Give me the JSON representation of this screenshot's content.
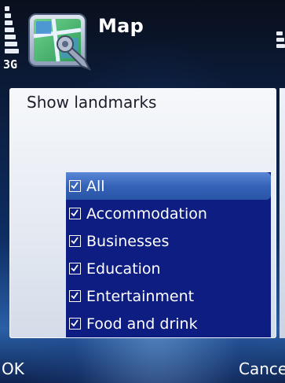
{
  "statusbar": {
    "network": "3G",
    "app_title": "Map",
    "app_icon": "map-app-icon",
    "signal_icon": "signal-strength-icon",
    "battery_icon": "battery-icon"
  },
  "dialog": {
    "title": "Show landmarks",
    "items": [
      {
        "label": "All",
        "checked": true,
        "selected": true
      },
      {
        "label": "Accommodation",
        "checked": true,
        "selected": false
      },
      {
        "label": "Businesses",
        "checked": true,
        "selected": false
      },
      {
        "label": "Education",
        "checked": true,
        "selected": false
      },
      {
        "label": "Entertainment",
        "checked": true,
        "selected": false
      },
      {
        "label": "Food and drink",
        "checked": true,
        "selected": false
      }
    ]
  },
  "softkeys": {
    "left": "OK",
    "right": "Cancel"
  },
  "colors": {
    "list_background": "#0e1d82",
    "selection": "#3563b8",
    "dialog_background": "#eef2f8"
  }
}
